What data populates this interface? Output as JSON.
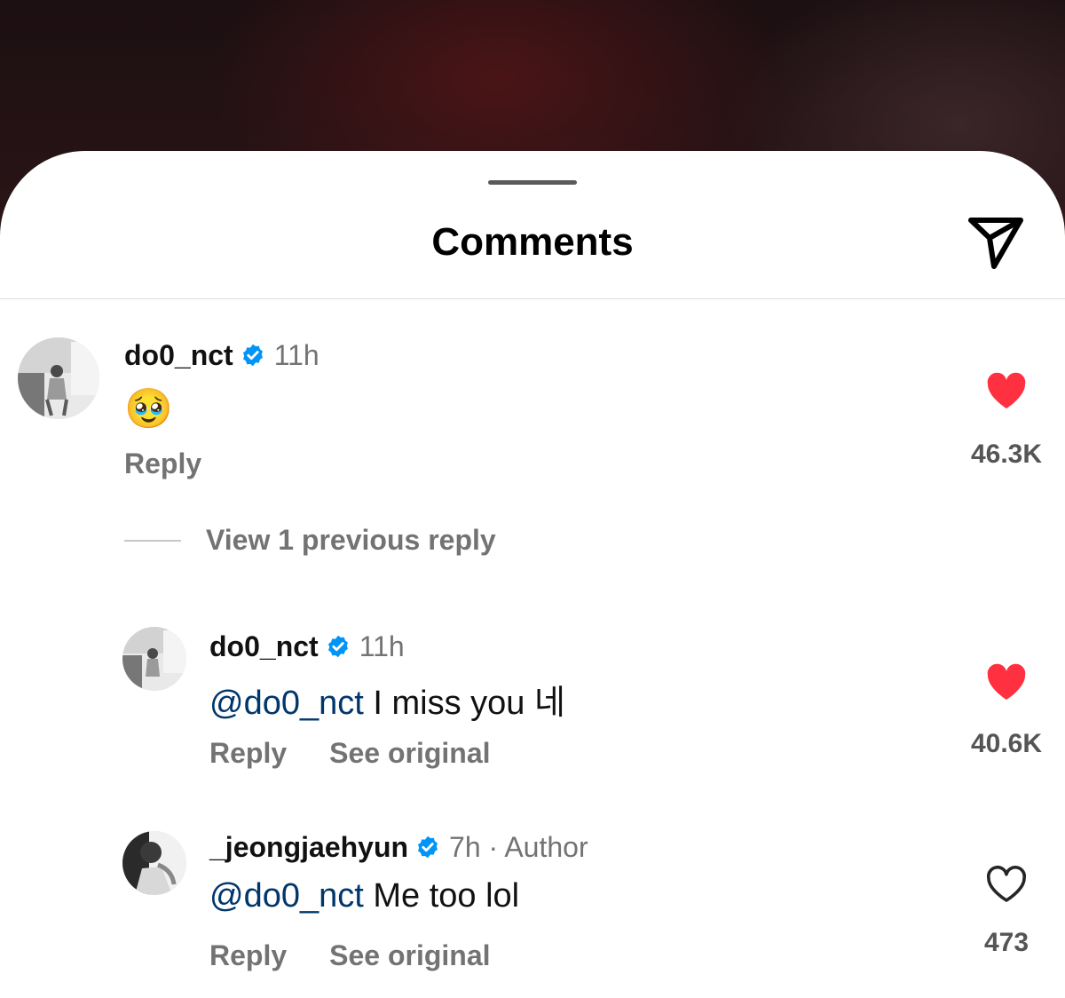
{
  "sheet": {
    "title": "Comments"
  },
  "comments": [
    {
      "username": "do0_nct",
      "time": "11h",
      "text": "🥹",
      "reply_label": "Reply",
      "likes": "46.3K",
      "liked": true
    }
  ],
  "view_replies": "View 1 previous reply",
  "replies": [
    {
      "username": "do0_nct",
      "time": "11h",
      "mention": "@do0_nct",
      "text": " I miss you 네",
      "reply_label": "Reply",
      "see_original_label": "See original",
      "likes": "40.6K",
      "liked": true
    },
    {
      "username": "_jeongjaehyun",
      "time": "7h",
      "author_tag": " · Author",
      "mention": "@do0_nct",
      "text": " Me too lol",
      "reply_label": "Reply",
      "see_original_label": "See original",
      "likes": "473",
      "liked": false
    }
  ],
  "colors": {
    "heart_liked": "#ff3040",
    "verified": "#0095f6",
    "mention": "#00376b",
    "muted": "#737373"
  },
  "icons": {
    "share": "paper-plane-icon",
    "verified": "verified-badge-icon",
    "like": "heart-icon"
  }
}
